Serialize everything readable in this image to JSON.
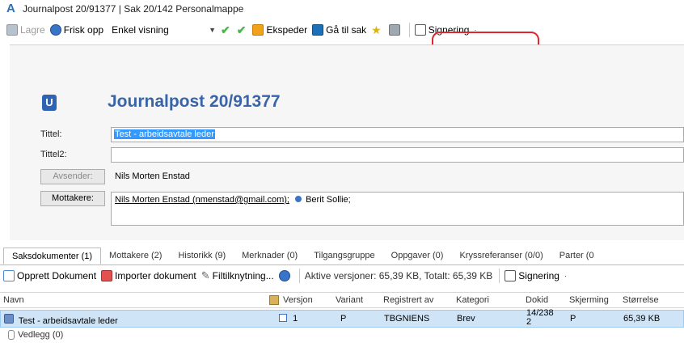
{
  "window": {
    "title": "Journalpost 20/91377 | Sak 20/142 Personalmappe"
  },
  "toolbar": {
    "save": "Lagre",
    "refresh": "Frisk opp",
    "view": "Enkel visning",
    "dispatch": "Ekspeder",
    "goto_case": "Gå til sak",
    "signing": "Signering"
  },
  "header": {
    "badge": "U",
    "title": "Journalpost 20/91377"
  },
  "form": {
    "title_label": "Tittel:",
    "title_value": "Test - arbeidsavtale leder",
    "title2_label": "Tittel2:",
    "title2_value": "",
    "sender_button": "Avsender:",
    "sender_value": "Nils Morten Enstad",
    "recipients_button": "Mottakere:",
    "recipient_1": "Nils Morten Enstad (nmenstad@gmail.com);",
    "recipient_2": "Berit Sollie;"
  },
  "tabs": [
    "Saksdokumenter (1)",
    "Mottakere (2)",
    "Historikk (9)",
    "Merknader (0)",
    "Tilgangsgruppe",
    "Oppgaver (0)",
    "Kryssreferanser (0/0)",
    "Parter (0"
  ],
  "doc_toolbar": {
    "create": "Opprett Dokument",
    "import": "Importer dokument",
    "file_link": "Filtilknytning...",
    "status": "Aktive versjoner: 65,39 KB,  Totalt: 65,39 KB",
    "signing": "Signering"
  },
  "table": {
    "columns": [
      "Navn",
      "Versjon",
      "Variant",
      "Registrert av",
      "Kategori",
      "Dokid",
      "Skjerming",
      "Størrelse"
    ],
    "row": {
      "name": "Test - arbeidsavtale leder",
      "version": "1",
      "variant": "P",
      "registered_by": "TBGNIENS",
      "category": "Brev",
      "dokid_line1": "14/238",
      "dokid_line2": "2",
      "screening": "P",
      "size": "65,39 KB"
    },
    "attachments": "Vedlegg (0)"
  },
  "colors": {
    "accent": "#3a64a8",
    "highlight_ring": "#e0262e",
    "row_selected": "#cfe4f7"
  }
}
